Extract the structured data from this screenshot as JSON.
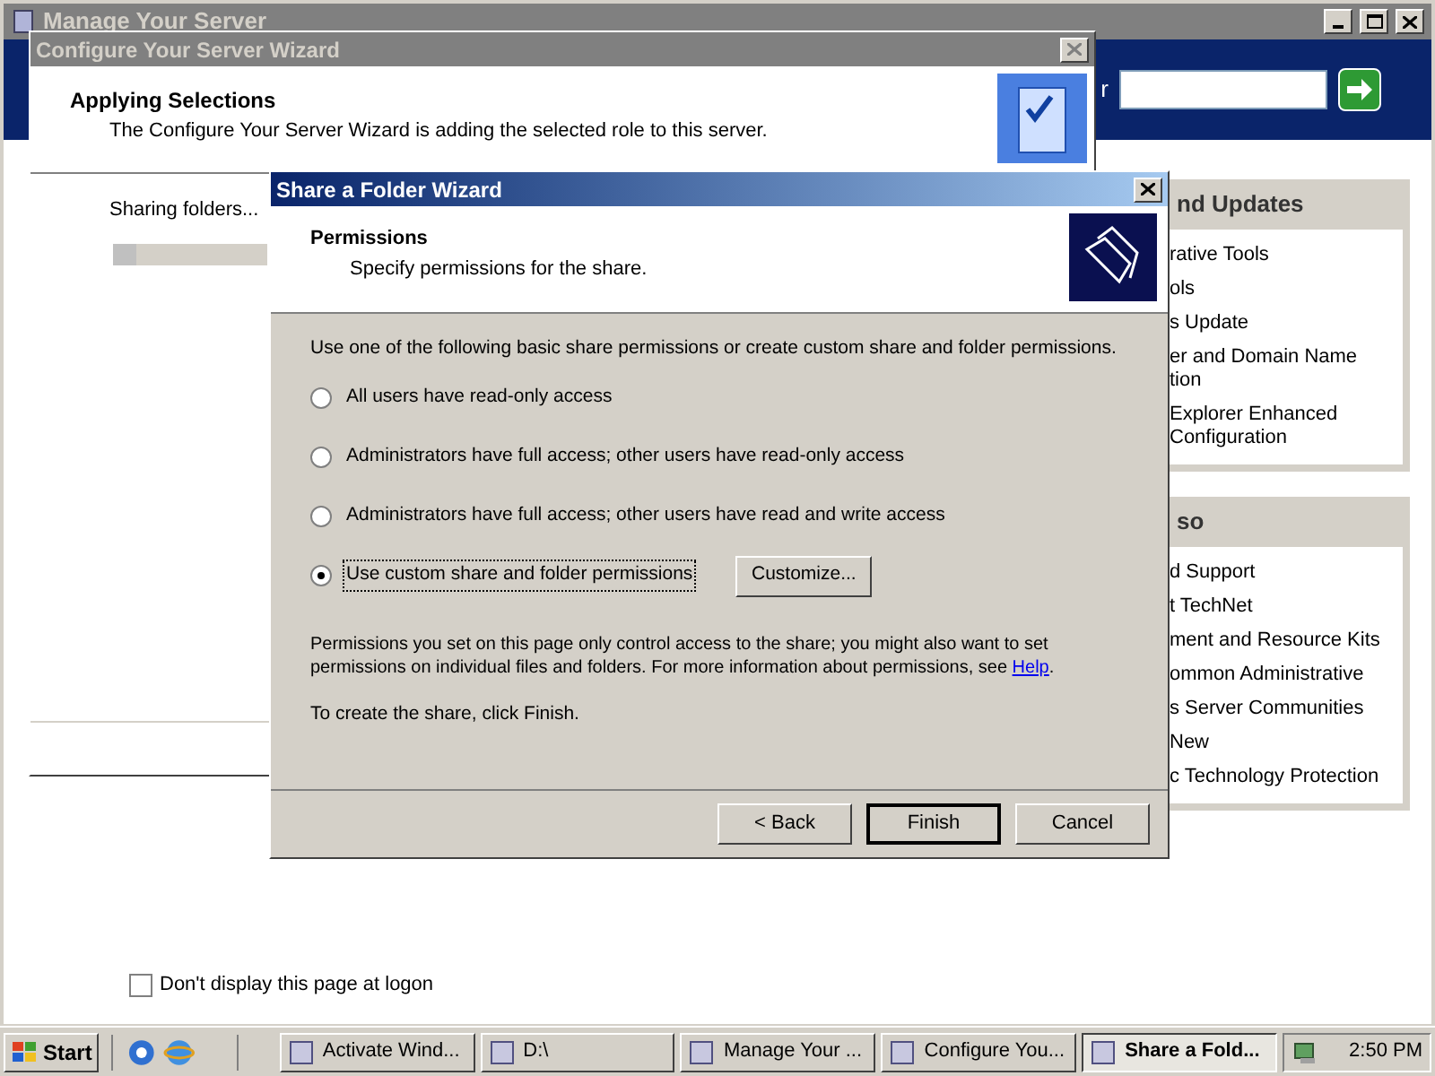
{
  "manage_window": {
    "title": "Manage Your Server",
    "search_label": "r",
    "panels": [
      {
        "heading": "nd Updates",
        "items": [
          {
            "lines": [
              "rative Tools"
            ]
          },
          {
            "lines": [
              "ols"
            ]
          },
          {
            "lines": [
              "s Update"
            ]
          },
          {
            "lines": [
              "er and Domain Name",
              "tion"
            ]
          },
          {
            "lines": [
              "Explorer Enhanced",
              "Configuration"
            ]
          }
        ]
      },
      {
        "heading": "so",
        "items": [
          {
            "lines": [
              "d Support"
            ]
          },
          {
            "lines": [
              "t TechNet"
            ]
          },
          {
            "lines": [
              "ment and Resource Kits"
            ]
          },
          {
            "lines": [
              "ommon Administrative"
            ]
          },
          {
            "lines": [
              "s Server Communities"
            ]
          },
          {
            "lines": [
              "New"
            ]
          },
          {
            "lines": [
              "c Technology Protection"
            ]
          }
        ]
      }
    ],
    "logon_checkbox": {
      "label": "Don't display this page at logon",
      "checked": false
    }
  },
  "configure_wizard": {
    "title": "Configure Your Server Wizard",
    "heading": "Applying Selections",
    "subtitle": "The Configure Your Server Wizard is adding the selected role to this server.",
    "status": "Sharing folders...",
    "progress": {
      "level": 0.15
    }
  },
  "share_wizard": {
    "title": "Share a Folder Wizard",
    "heading": "Permissions",
    "subtitle": "Specify permissions for the share.",
    "intro": "Use one of the following basic share permissions or create custom share and folder permissions.",
    "options": [
      {
        "label": "All users have read-only access",
        "selected": false
      },
      {
        "label": "Administrators have full access; other users have read-only access",
        "selected": false
      },
      {
        "label": "Administrators have full access; other users have read and write access",
        "selected": false
      },
      {
        "label": "Use custom share and folder permissions",
        "selected": true
      }
    ],
    "customize_button": "Customize...",
    "note": "Permissions you set on this page only control access to the share; you might also want to set permissions on individual files and folders. For more information about permissions, see",
    "note_link": "Help",
    "note_end": ".",
    "finish_note": "To create the share, click Finish.",
    "buttons": [
      "< Back",
      "Finish",
      "Cancel"
    ]
  },
  "taskbar": {
    "start": "Start",
    "tasks": [
      {
        "label": "Activate Wind...",
        "selected": false
      },
      {
        "label": "D:\\",
        "selected": false
      },
      {
        "label": "Manage Your ...",
        "selected": false
      },
      {
        "label": "Configure You...",
        "selected": false
      },
      {
        "label": "Share a Fold...",
        "selected": true
      }
    ],
    "clock": "2:50 PM"
  }
}
